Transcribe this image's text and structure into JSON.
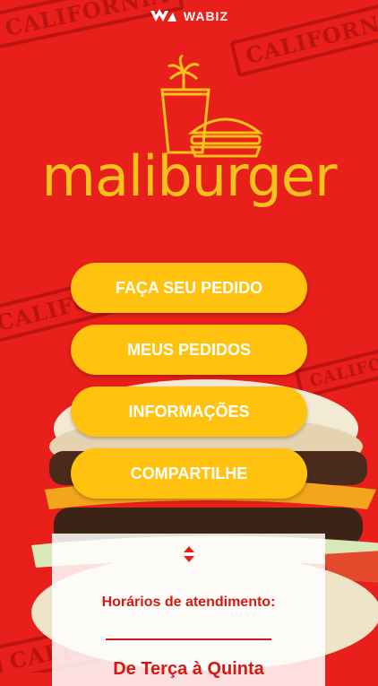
{
  "header": {
    "brand": "WABIZ"
  },
  "restaurant": {
    "name": "maliburger"
  },
  "stamps": [
    "CALIFORNIA",
    "CALIFORNIA",
    "CALIFORNIA",
    "CALIFORNIA",
    "CALIFORNIA"
  ],
  "menu": {
    "order": "FAÇA SEU PEDIDO",
    "my_orders": "MEUS PEDIDOS",
    "info": "INFORMAÇÕES",
    "share": "COMPARTILHE"
  },
  "hours": {
    "toggle_icon": "up-down-chevron-icon",
    "title": "Horários de atendimento:",
    "days": "De Terça à Quinta"
  },
  "colors": {
    "background": "#e81f1a",
    "button": "#ffc20e",
    "accent": "#d21a14",
    "logo": "#f7c21a"
  }
}
